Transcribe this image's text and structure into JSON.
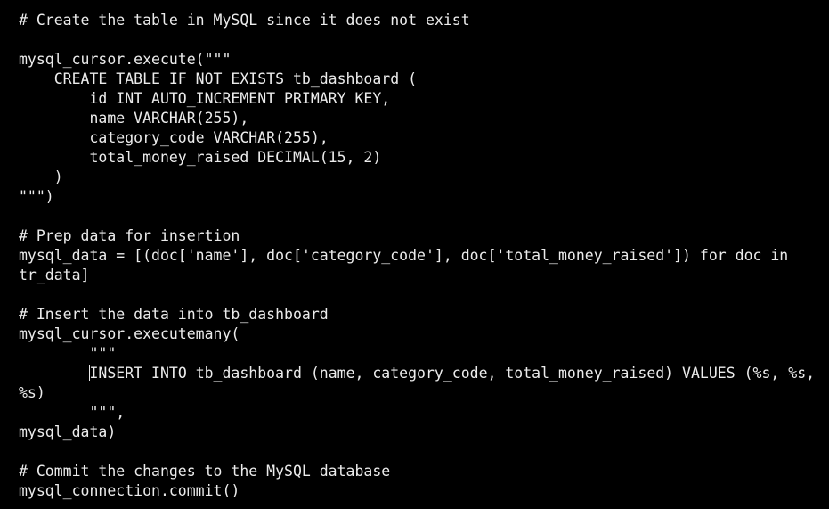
{
  "editor": {
    "lines": [
      "# Create the table in MySQL since it does not exist",
      "",
      "mysql_cursor.execute(\"\"\"",
      "    CREATE TABLE IF NOT EXISTS tb_dashboard (",
      "        id INT AUTO_INCREMENT PRIMARY KEY,",
      "        name VARCHAR(255),",
      "        category_code VARCHAR(255),",
      "        total_money_raised DECIMAL(15, 2)",
      "    )",
      "\"\"\")",
      "",
      "# Prep data for insertion",
      "mysql_data = [(doc['name'], doc['category_code'], doc['total_money_raised']) for doc in",
      "tr_data]",
      "",
      "# Insert the data into tb_dashboard",
      "mysql_cursor.executemany(",
      "        \"\"\"",
      "        INSERT INTO tb_dashboard (name, category_code, total_money_raised) VALUES (%s, %s,",
      "%s)",
      "        \"\"\",",
      "mysql_data)",
      "",
      "# Commit the changes to the MySQL database",
      "mysql_connection.commit()"
    ]
  }
}
